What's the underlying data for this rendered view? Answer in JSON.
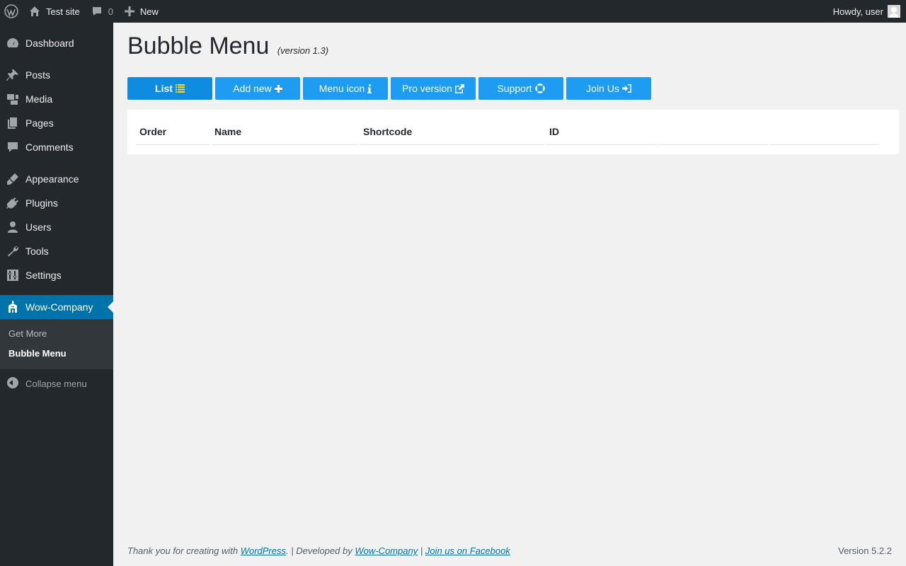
{
  "adminbar": {
    "site_name": "Test site",
    "comments_count": "0",
    "new_label": "New",
    "greeting": "Howdy, user"
  },
  "sidebar": {
    "items": [
      {
        "label": "Dashboard",
        "icon": "dashboard-icon"
      },
      {
        "label": "Posts",
        "icon": "pin-icon"
      },
      {
        "label": "Media",
        "icon": "media-icon"
      },
      {
        "label": "Pages",
        "icon": "pages-icon"
      },
      {
        "label": "Comments",
        "icon": "comment-icon"
      },
      {
        "label": "Appearance",
        "icon": "brush-icon"
      },
      {
        "label": "Plugins",
        "icon": "plug-icon"
      },
      {
        "label": "Users",
        "icon": "user-icon"
      },
      {
        "label": "Tools",
        "icon": "wrench-icon"
      },
      {
        "label": "Settings",
        "icon": "settings-icon"
      },
      {
        "label": "Wow-Company",
        "icon": "building-icon"
      }
    ],
    "submenu": [
      "Get More",
      "Bubble Menu"
    ],
    "collapse_label": "Collapse menu"
  },
  "page": {
    "title": "Bubble Menu",
    "version": "(version 1.3)"
  },
  "buttons": {
    "list": "List",
    "add_new": "Add new",
    "menu_icon": "Menu icon",
    "pro_version": "Pro version",
    "support": "Support",
    "join_us": "Join Us"
  },
  "table": {
    "headers": [
      "Order",
      "Name",
      "Shortcode",
      "ID",
      "",
      ""
    ]
  },
  "footer": {
    "thanks_prefix": "Thank you for creating with",
    "wordpress_link": "WordPress",
    "developed_by": ". | Developed by",
    "company_link": "Wow-Company",
    "separator": "|",
    "facebook_link": "Join us on Facebook",
    "version": "Version 5.2.2"
  },
  "colors": {
    "adminbar_bg": "#23282d",
    "accent": "#0073aa",
    "button_bg": "#1e9cf1"
  }
}
